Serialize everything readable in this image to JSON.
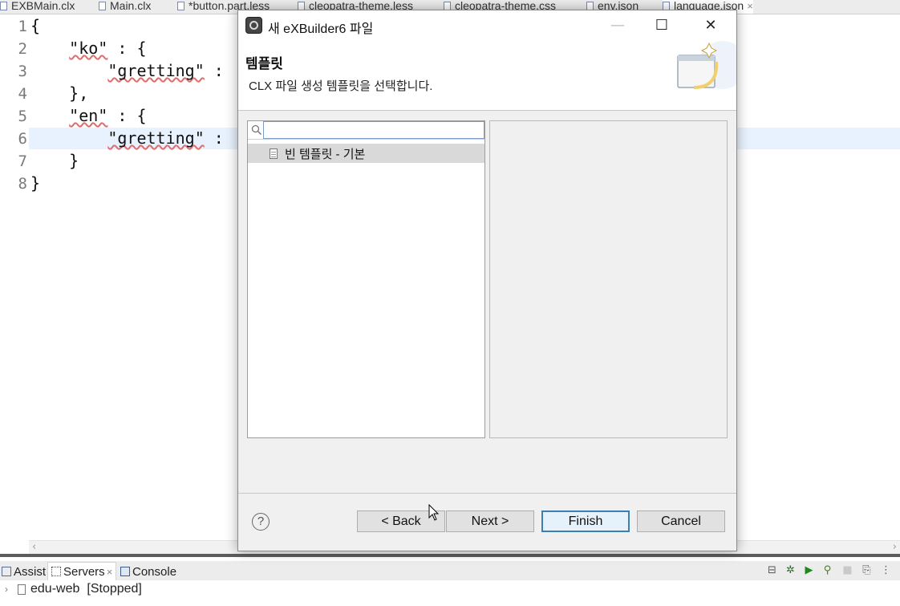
{
  "editor_tabs": [
    {
      "label": "EXBMain.clx"
    },
    {
      "label": "Main.clx"
    },
    {
      "label": "*button.part.less"
    },
    {
      "label": "cleopatra-theme.less"
    },
    {
      "label": "cleopatra-theme.css"
    },
    {
      "label": "env.json"
    },
    {
      "label": "language.json",
      "close": "×"
    }
  ],
  "editor": {
    "line_numbers": [
      "1",
      "2",
      "3",
      "4",
      "5",
      "6",
      "7",
      "8"
    ],
    "lines": {
      "l1": "{",
      "l2a": "    ",
      "l2s": "\"ko\"",
      "l2b": " : {",
      "l3a": "        ",
      "l3s": "\"gretting\"",
      "l3b": " :",
      "l4": "    },",
      "l5a": "    ",
      "l5s": "\"en\"",
      "l5b": " : {",
      "l6a": "        ",
      "l6s": "\"gretting\"",
      "l6b": " :",
      "l7": "    }",
      "l8": "}"
    },
    "current_line": 6
  },
  "dialog": {
    "title": "새 eXBuilder6 파일",
    "window_buttons": {
      "minimize": "—",
      "maximize": "☐",
      "close": "✕"
    },
    "banner_title": "템플릿",
    "banner_description": "CLX 파일 생성 템플릿을 선택합니다.",
    "search": {
      "value": "",
      "placeholder": ""
    },
    "templates": [
      {
        "label": "빈 템플릿 - 기본",
        "selected": true
      }
    ],
    "help_label": "?",
    "buttons": {
      "back": "< Back",
      "next": "Next >",
      "finish": "Finish",
      "cancel": "Cancel"
    },
    "default_button": "finish"
  },
  "bottom_views": {
    "tabs": [
      {
        "label": "Assist"
      },
      {
        "label": "Servers",
        "active": true,
        "close": "×"
      },
      {
        "label": "Console"
      }
    ],
    "servers": [
      {
        "name": "edu-web",
        "status": "[Stopped]"
      }
    ]
  },
  "colors": {
    "current_line": "#e8f2fe",
    "default_button_border": "#3c7fb1",
    "tree_selection": "#d9d9d9"
  }
}
